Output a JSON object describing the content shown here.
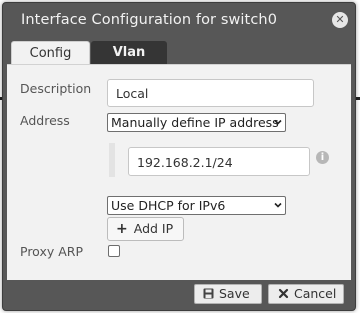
{
  "dialog": {
    "title": "Interface Configuration for switch0",
    "close_glyph": "✕"
  },
  "tabs": [
    {
      "label": "Config",
      "active": true
    },
    {
      "label": "Vlan",
      "active": false
    }
  ],
  "form": {
    "description_label": "Description",
    "description_value": "Local",
    "address_label": "Address",
    "address_mode": "Manually define IP address",
    "ip_value": "192.168.2.1/24",
    "ipv6_mode": "Use DHCP for IPv6",
    "add_ip_label": "Add IP",
    "proxy_arp_label": "Proxy ARP",
    "proxy_arp_checked": false
  },
  "footer": {
    "save_label": "Save",
    "cancel_label": "Cancel"
  },
  "icons": {
    "close": "close-icon",
    "info": "info-icon",
    "plus": "plus-icon",
    "save": "floppy-disk-icon",
    "cancel": "x-icon"
  },
  "colors": {
    "dialog_bg": "#575757",
    "panel_bg": "#f2f2f2",
    "active_tab_bg": "#f2f2f2",
    "inactive_tab_bg": "#353535",
    "title_text": "#f2f2f2"
  }
}
